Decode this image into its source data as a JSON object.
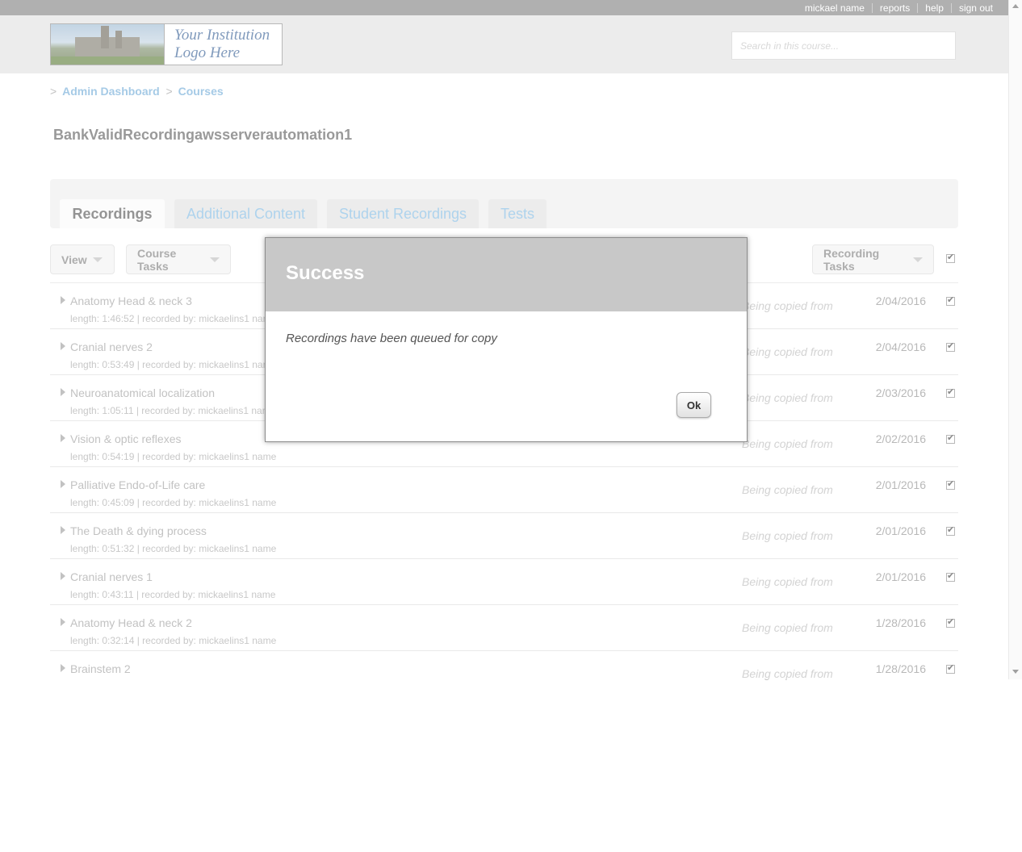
{
  "topbar": {
    "links": [
      "mickael name",
      "reports",
      "help",
      "sign out"
    ]
  },
  "header": {
    "logo_text_line1": "Your Institution",
    "logo_text_line2": "Logo Here",
    "search_placeholder": "Search in this course..."
  },
  "breadcrumb": {
    "items": [
      "Admin Dashboard",
      "Courses"
    ],
    "separator": ">"
  },
  "course": {
    "title": "BankValidRecordingawsserverautomation1"
  },
  "tabs": [
    {
      "label": "Recordings",
      "active": true
    },
    {
      "label": "Additional Content",
      "active": false
    },
    {
      "label": "Student Recordings",
      "active": false
    },
    {
      "label": "Tests",
      "active": false
    }
  ],
  "toolbar": {
    "view_label": "View",
    "course_tasks_label": "Course Tasks",
    "recording_tasks_label": "Recording Tasks"
  },
  "recordings": [
    {
      "title": "Anatomy Head & neck 3",
      "meta": "length: 1:46:52 | recorded by: mickaelins1 name",
      "status": "Being copied from",
      "date": "2/04/2016"
    },
    {
      "title": "Cranial nerves 2",
      "meta": "length: 0:53:49 | recorded by: mickaelins1 name",
      "status": "Being copied from",
      "date": "2/04/2016"
    },
    {
      "title": "Neuroanatomical localization",
      "meta": "length: 1:05:11 | recorded by: mickaelins1 name",
      "status": "Being copied from",
      "date": "2/03/2016"
    },
    {
      "title": "Vision & optic reflexes",
      "meta": "length: 0:54:19 | recorded by: mickaelins1 name",
      "status": "Being copied from",
      "date": "2/02/2016"
    },
    {
      "title": "Palliative Endo-of-Life care",
      "meta": "length: 0:45:09 | recorded by: mickaelins1 name",
      "status": "Being copied from",
      "date": "2/01/2016"
    },
    {
      "title": "The Death & dying process",
      "meta": "length: 0:51:32 | recorded by: mickaelins1 name",
      "status": "Being copied from",
      "date": "2/01/2016"
    },
    {
      "title": "Cranial nerves 1",
      "meta": "length: 0:43:11 | recorded by: mickaelins1 name",
      "status": "Being copied from",
      "date": "2/01/2016"
    },
    {
      "title": "Anatomy Head & neck 2",
      "meta": "length: 0:32:14 | recorded by: mickaelins1 name",
      "status": "Being copied from",
      "date": "1/28/2016"
    },
    {
      "title": "Brainstem 2",
      "meta": "",
      "status": "Being copied from",
      "date": "1/28/2016"
    }
  ],
  "modal": {
    "title": "Success",
    "message": "Recordings have been queued for copy",
    "ok_label": "Ok"
  }
}
